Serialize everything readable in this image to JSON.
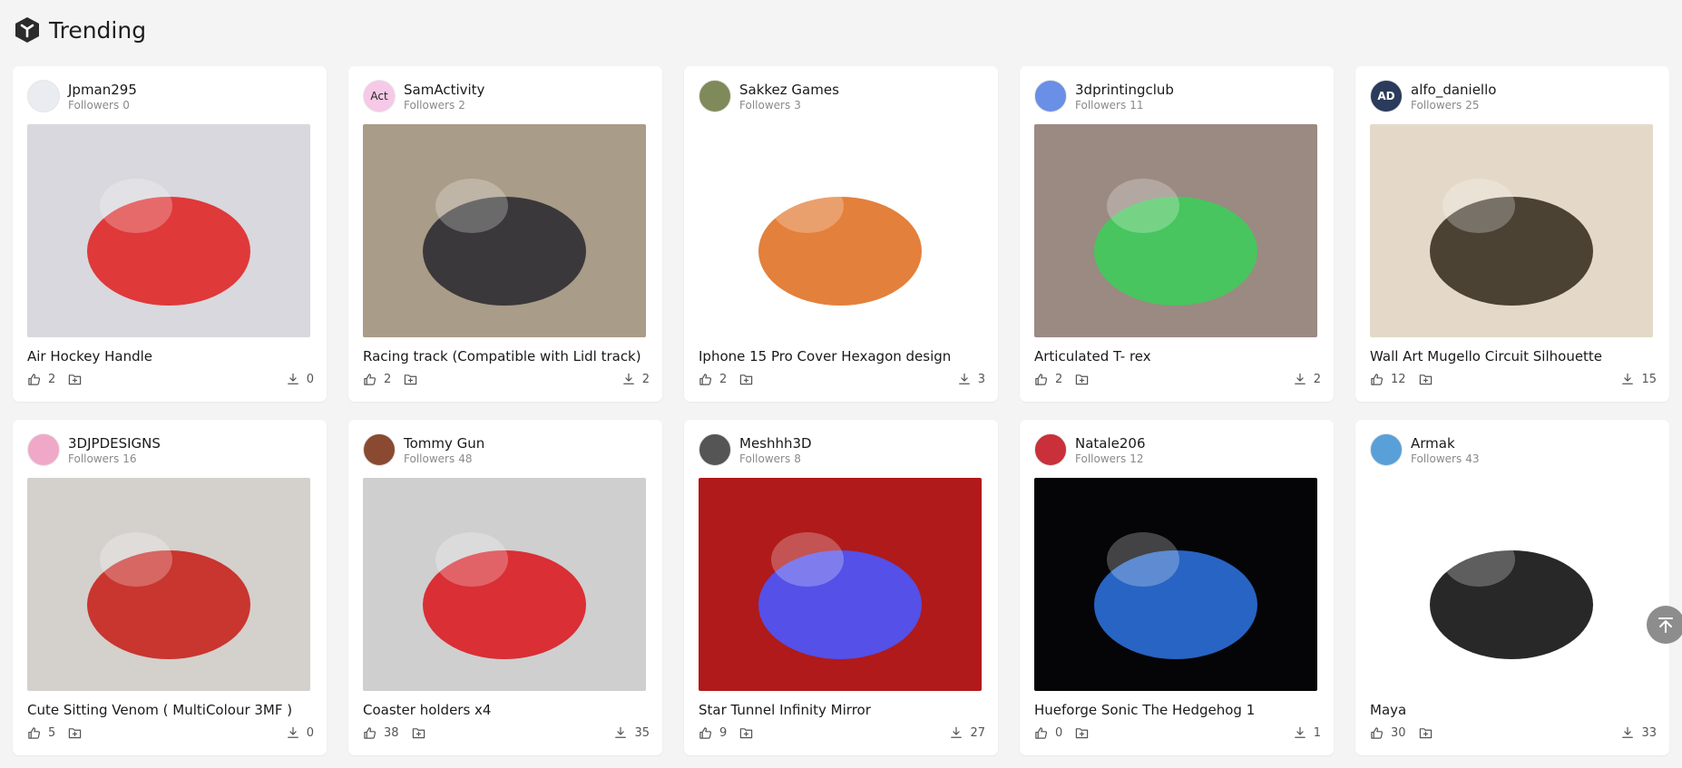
{
  "page": {
    "title": "Trending"
  },
  "labels": {
    "followers": "Followers"
  },
  "cards": [
    {
      "user": "Jpman295",
      "followers": "0",
      "title": "Air Hockey Handle",
      "likes": "2",
      "downloads": "0",
      "avatar_text": "",
      "avatar_color": "#e9ecf1",
      "thumb_color": "#d8d8de",
      "thumb_accent": "#e02828"
    },
    {
      "user": "SamActivity",
      "followers": "2",
      "title": "Racing track (Compatible with Lidl track)",
      "likes": "2",
      "downloads": "2",
      "avatar_text": "Act",
      "avatar_color": "#f6c9e6",
      "thumb_color": "#a99c88",
      "thumb_accent": "#2e2e32"
    },
    {
      "user": "Sakkez Games",
      "followers": "3",
      "title": "Iphone 15 Pro Cover Hexagon design",
      "likes": "2",
      "downloads": "3",
      "avatar_text": "",
      "avatar_color": "#7f8a5a",
      "thumb_color": "#ffffff",
      "thumb_accent": "#e07226"
    },
    {
      "user": "3dprintingclub",
      "followers": "11",
      "title": "Articulated T- rex",
      "likes": "2",
      "downloads": "2",
      "avatar_text": "",
      "avatar_color": "#6a8fe6",
      "thumb_color": "#9a8a82",
      "thumb_accent": "#3fcb5a"
    },
    {
      "user": "alfo_daniello",
      "followers": "25",
      "title": "Wall Art Mugello Circuit Silhouette",
      "likes": "12",
      "downloads": "15",
      "avatar_text": "AD",
      "avatar_color": "#2a3b5c",
      "thumb_color": "#e4d9c9",
      "thumb_accent": "#3a3124"
    },
    {
      "user": "3DJPDESIGNS",
      "followers": "16",
      "title": "Cute Sitting Venom ( MultiColour 3MF )",
      "likes": "5",
      "downloads": "0",
      "avatar_text": "",
      "avatar_color": "#f0a8c8",
      "thumb_color": "#d4d0cc",
      "thumb_accent": "#c8231e"
    },
    {
      "user": "Tommy Gun",
      "followers": "48",
      "title": "Coaster holders x4",
      "likes": "38",
      "downloads": "35",
      "avatar_text": "",
      "avatar_color": "#8a4a32",
      "thumb_color": "#cfcfcf",
      "thumb_accent": "#d91d24"
    },
    {
      "user": "Meshhh3D",
      "followers": "8",
      "title": "Star Tunnel Infinity Mirror",
      "likes": "9",
      "downloads": "27",
      "avatar_text": "",
      "avatar_color": "#555555",
      "thumb_color": "#b01a1a",
      "thumb_accent": "#4a56ff"
    },
    {
      "user": "Natale206",
      "followers": "12",
      "title": "Hueforge Sonic The Hedgehog 1",
      "likes": "0",
      "downloads": "1",
      "avatar_text": "",
      "avatar_color": "#c9303a",
      "thumb_color": "#050508",
      "thumb_accent": "#2c6fd8"
    },
    {
      "user": "Armak",
      "followers": "43",
      "title": "Maya",
      "likes": "30",
      "downloads": "33",
      "avatar_text": "",
      "avatar_color": "#5aa0d8",
      "thumb_color": "#ffffff",
      "thumb_accent": "#111111"
    }
  ]
}
